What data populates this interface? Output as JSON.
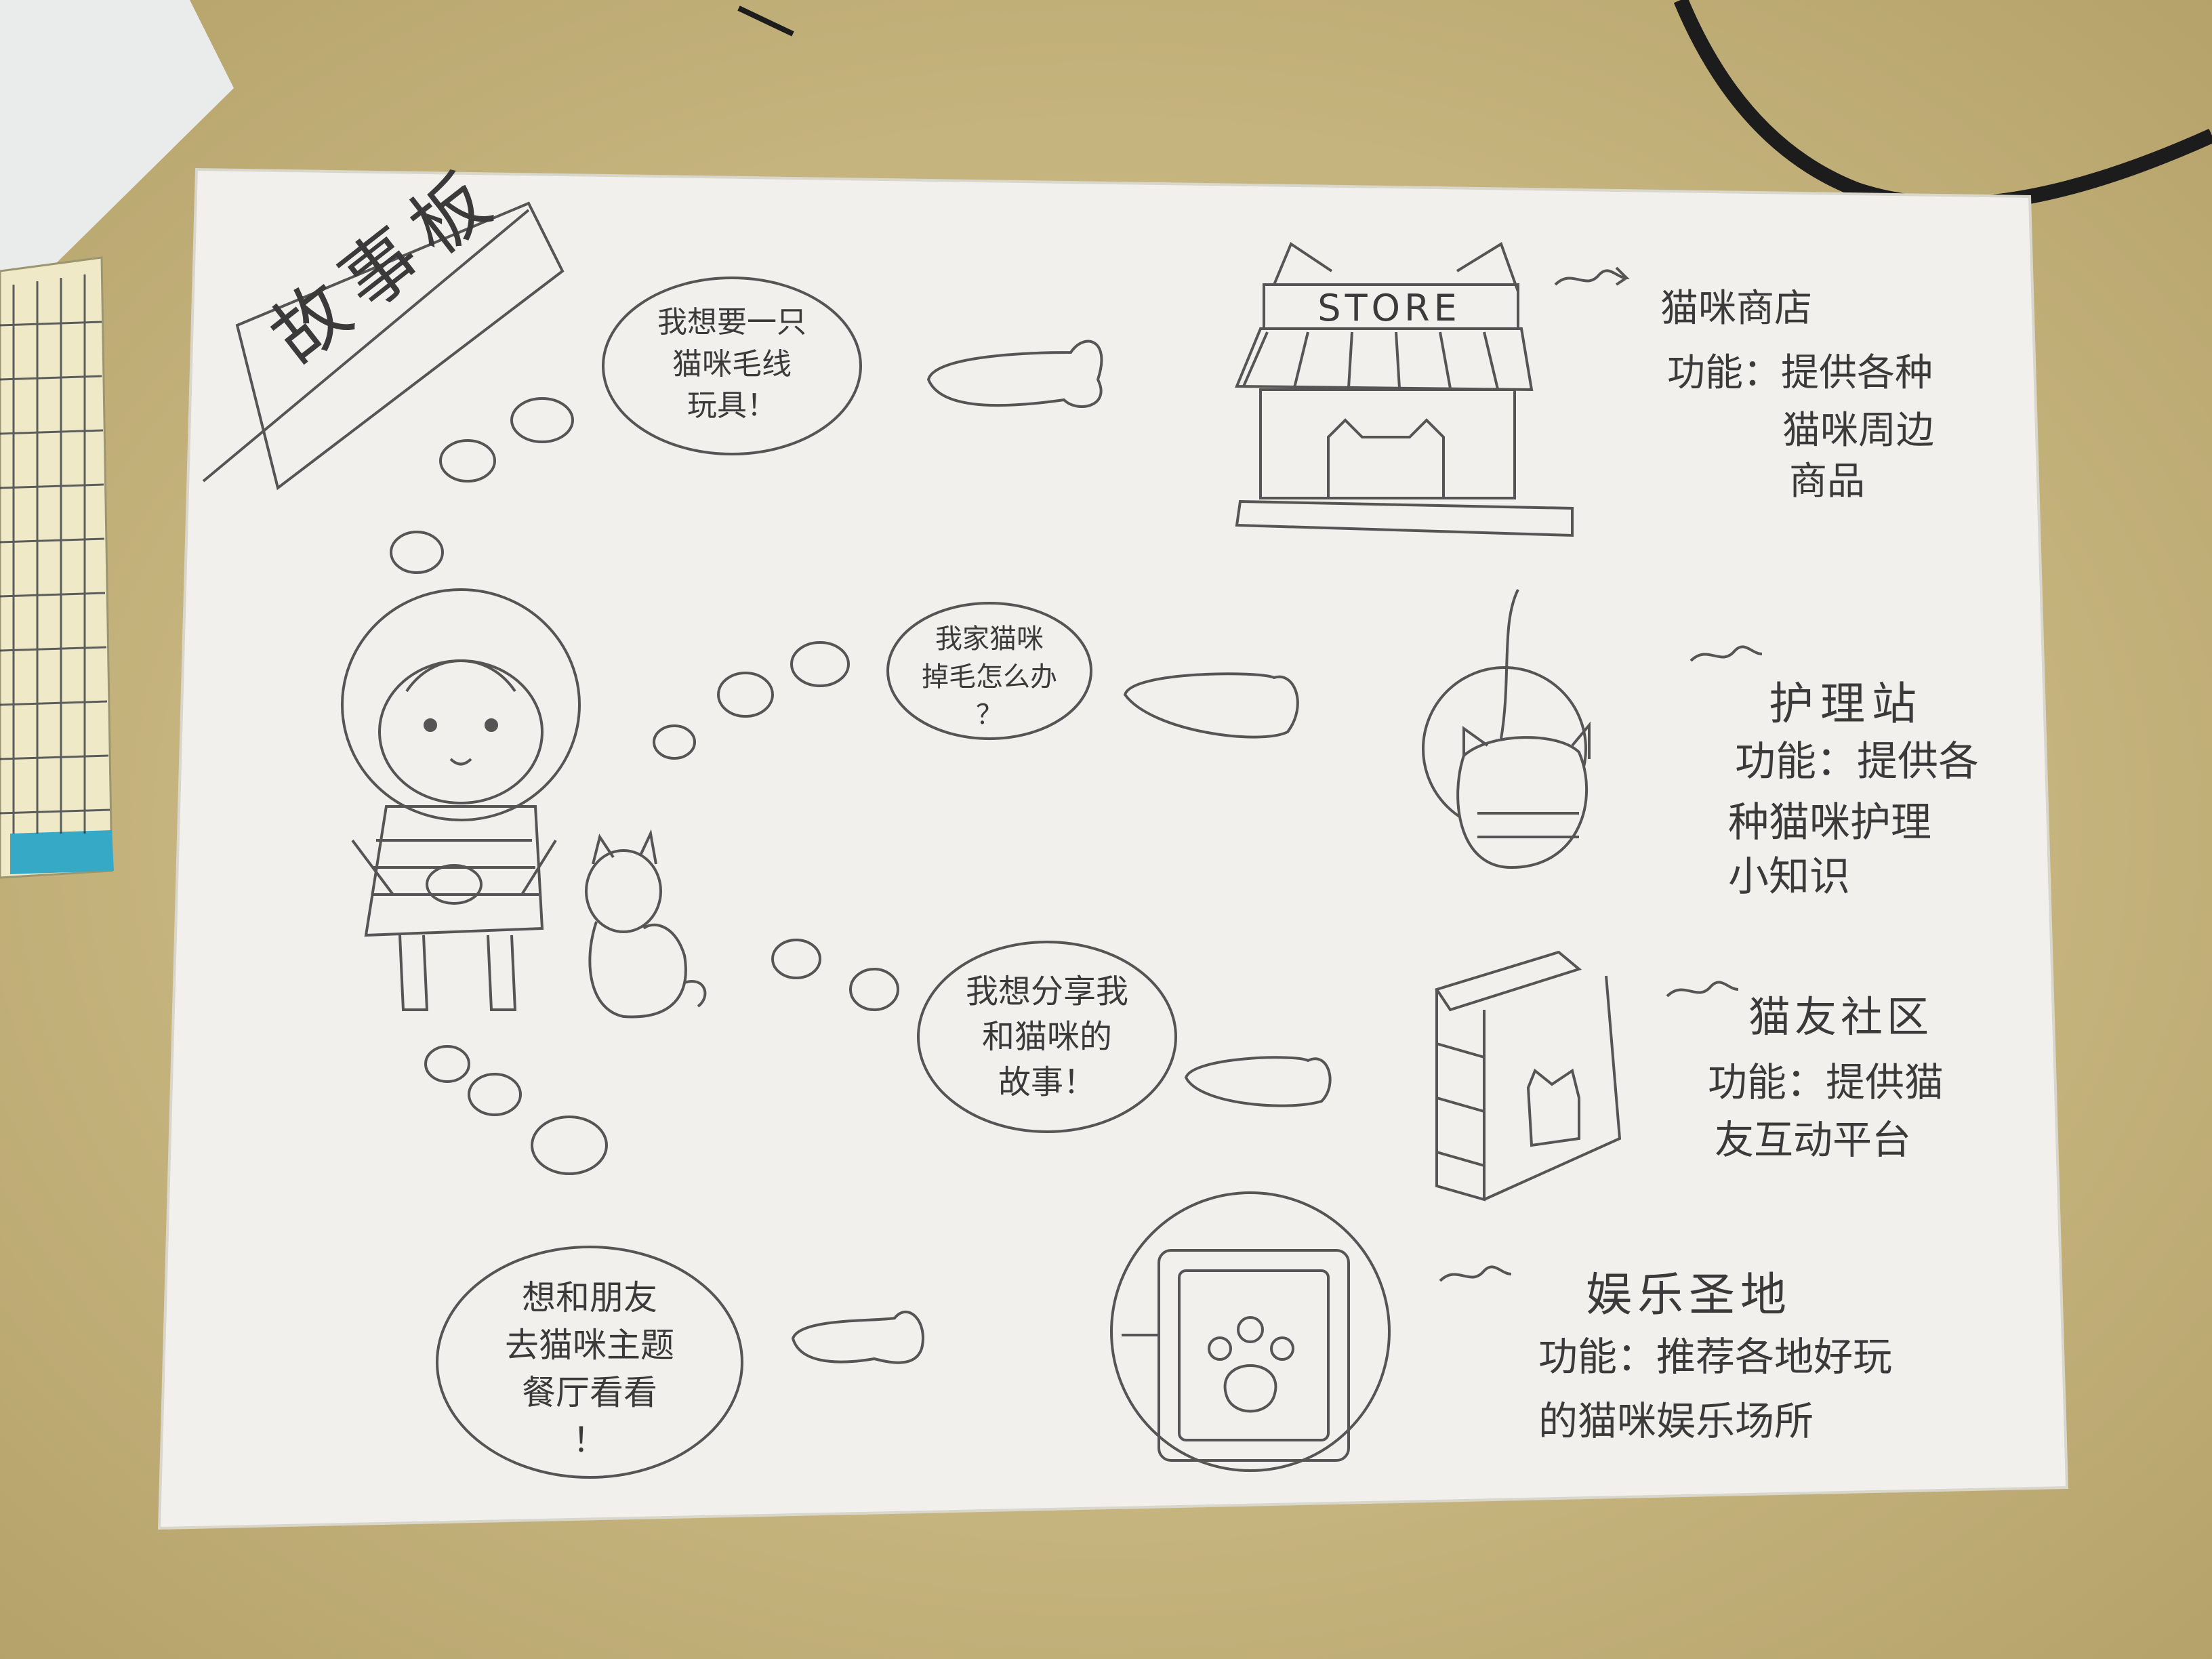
{
  "colors": {
    "desk": "#c9b785",
    "paper": "#f1f0ec",
    "pencil": "#3a3a3a",
    "ruler_blue": "#35a9c6"
  },
  "title": "故事板",
  "thoughts": [
    {
      "lines": [
        "我想要一只",
        "猫咪毛线",
        "玩具！"
      ]
    },
    {
      "lines": [
        "我家猫咪",
        "掉毛怎么办",
        "？"
      ]
    },
    {
      "lines": [
        "我想分享我",
        "和猫咪的",
        "故事！"
      ]
    },
    {
      "lines": [
        "想和朋友",
        "去猫咪主题",
        "餐厅看看",
        "！"
      ]
    }
  ],
  "store_sign": "STORE",
  "features": [
    {
      "name": "猫咪商店",
      "desc_lines": [
        "功能：提供各种",
        "猫咪周边",
        "商品"
      ],
      "icon": "store-icon"
    },
    {
      "name": "护理站",
      "desc_lines": [
        "功能：提供各",
        "种猫咪护理",
        "小知识"
      ],
      "icon": "cat-care-icon"
    },
    {
      "name": "猫友社区",
      "desc_lines": [
        "功能：提供猫",
        "友互动平台"
      ],
      "icon": "book-community-icon"
    },
    {
      "name": "娱乐圣地",
      "desc_lines": [
        "功能：推荐各地好玩",
        "的猫咪娱乐场所"
      ],
      "icon": "paw-tablet-icon"
    }
  ]
}
